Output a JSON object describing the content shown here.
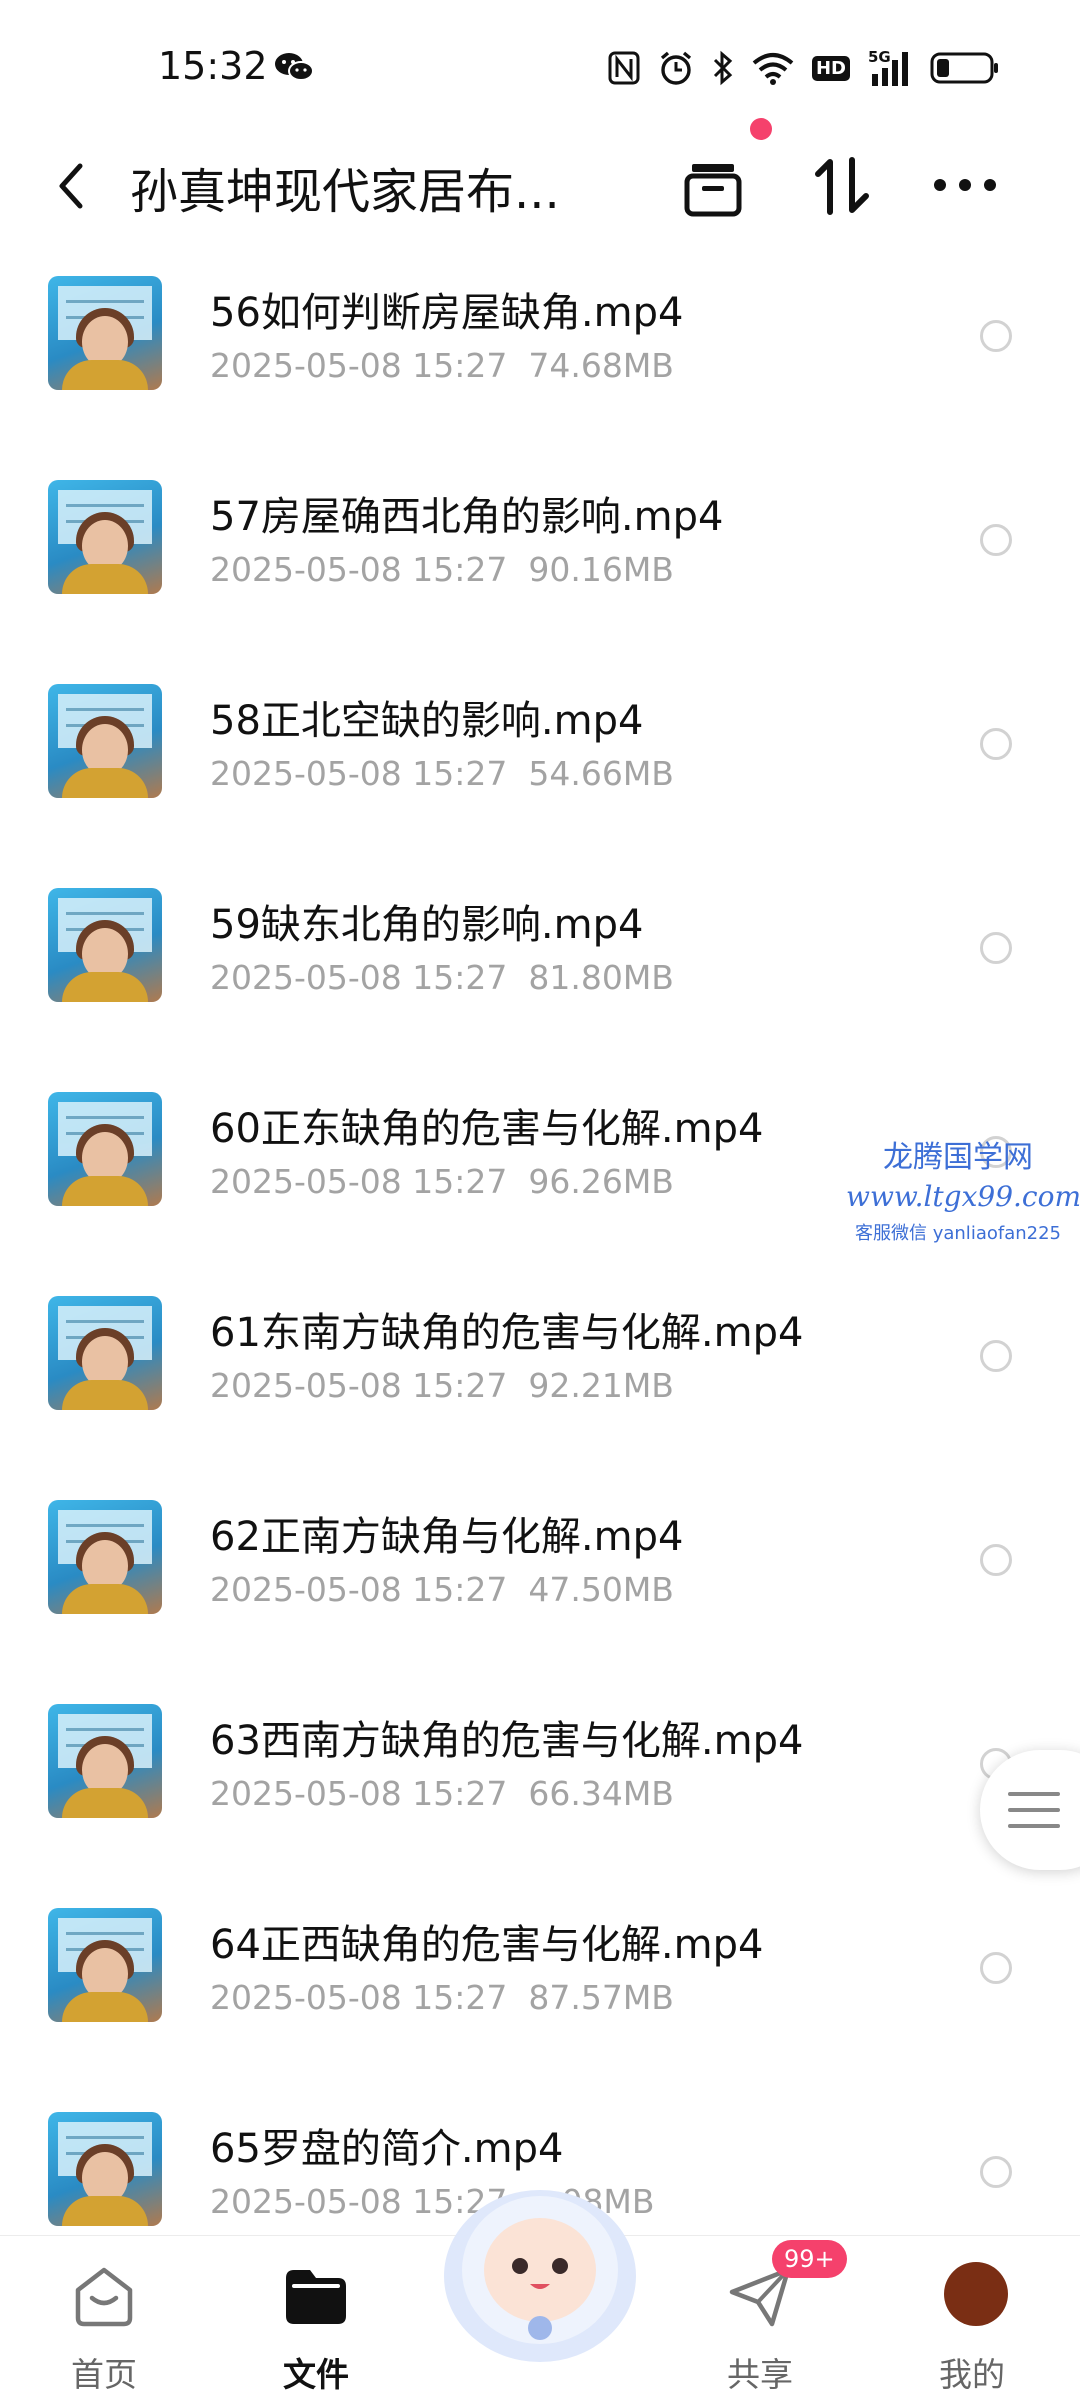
{
  "status_bar": {
    "time": "15:32",
    "icons": [
      "wechat-icon",
      "nfc-icon",
      "alarm-icon",
      "bluetooth-icon",
      "wifi-icon",
      "hd-icon",
      "signal-5g-icon",
      "battery-icon"
    ],
    "hd_label": "HD",
    "network_label": "5G"
  },
  "header": {
    "title": "孙真坤现代家居布...",
    "icons": [
      "back-icon",
      "archive-icon",
      "sort-icon",
      "more-icon"
    ]
  },
  "files": [
    {
      "name": "56如何判断房屋缺角.mp4",
      "date": "2025-05-08  15:27",
      "size": "74.68MB"
    },
    {
      "name": "57房屋确西北角的影响.mp4",
      "date": "2025-05-08  15:27",
      "size": "90.16MB"
    },
    {
      "name": "58正北空缺的影响.mp4",
      "date": "2025-05-08  15:27",
      "size": "54.66MB"
    },
    {
      "name": "59缺东北角的影响.mp4",
      "date": "2025-05-08  15:27",
      "size": "81.80MB"
    },
    {
      "name": "60正东缺角的危害与化解.mp4",
      "date": "2025-05-08  15:27",
      "size": "96.26MB"
    },
    {
      "name": "61东南方缺角的危害与化解.mp4",
      "date": "2025-05-08  15:27",
      "size": "92.21MB"
    },
    {
      "name": "62正南方缺角与化解.mp4",
      "date": "2025-05-08  15:27",
      "size": "47.50MB"
    },
    {
      "name": "63西南方缺角的危害与化解.mp4",
      "date": "2025-05-08  15:27",
      "size": "66.34MB"
    },
    {
      "name": "64正西缺角的危害与化解.mp4",
      "date": "2025-05-08  15:27",
      "size": "87.57MB"
    },
    {
      "name": "65罗盘的简介.mp4",
      "date": "2025-05-08  15:27",
      "size": "…08MB"
    }
  ],
  "watermark": {
    "line1": "龙腾国学网",
    "line2": "www.ltgx99.com",
    "line3": "客服微信 yanliaofan225"
  },
  "bottom_nav": {
    "items": [
      {
        "label": "首页",
        "icon": "home-icon"
      },
      {
        "label": "文件",
        "icon": "folder-icon"
      },
      {
        "label": "共享",
        "icon": "paper-plane-icon"
      },
      {
        "label": "我的",
        "icon": "avatar-icon"
      }
    ],
    "share_badge": "99+",
    "active": "文件"
  },
  "colors": {
    "accent_red": "#f5416c",
    "meta_gray": "#a3a3a3",
    "watermark_blue": "#3d6fd6"
  }
}
